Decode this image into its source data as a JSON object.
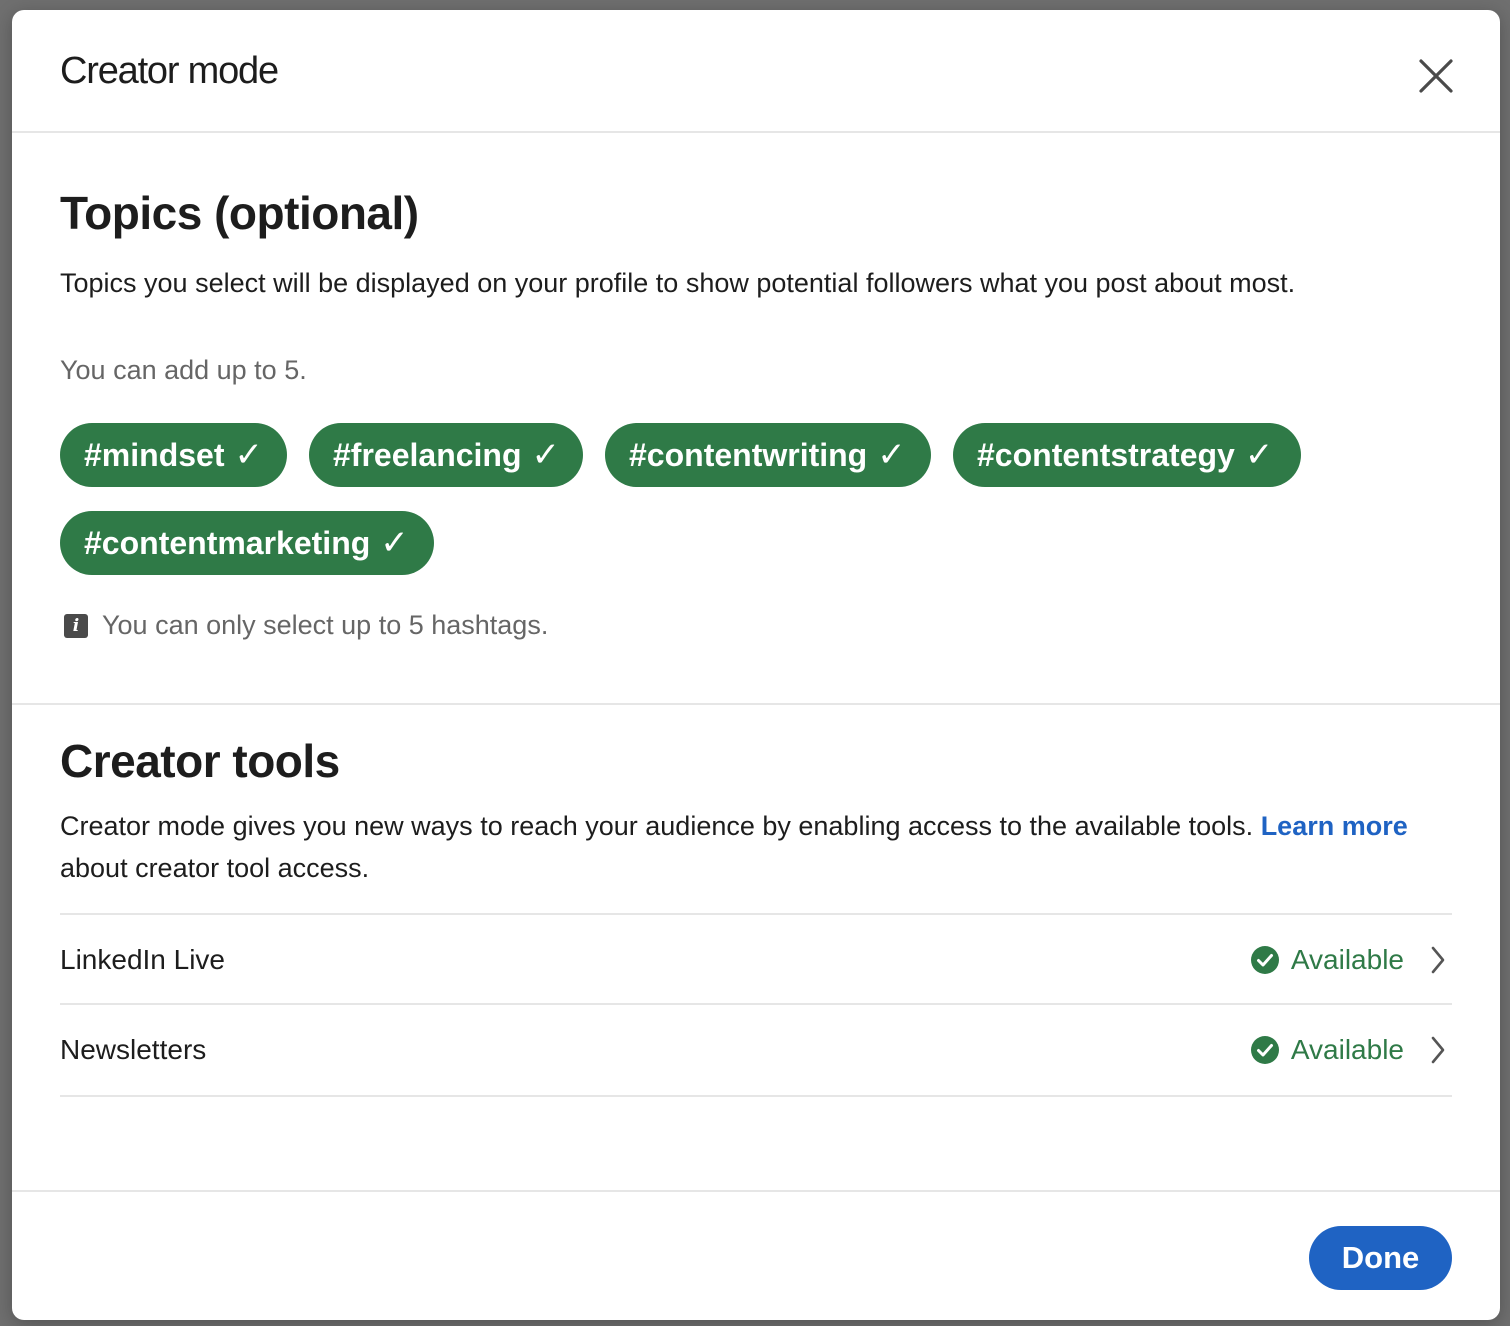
{
  "dialog": {
    "title": "Creator mode",
    "close_icon": "close-icon"
  },
  "topics": {
    "heading": "Topics (optional)",
    "description": "Topics you select will be displayed on your profile to show potential followers what you post about most.",
    "limit_text": "You can add up to 5.",
    "check_glyph": "✓",
    "chips": [
      {
        "label": "#mindset",
        "selected": true
      },
      {
        "label": "#freelancing",
        "selected": true
      },
      {
        "label": "#contentwriting",
        "selected": true
      },
      {
        "label": "#contentstrategy",
        "selected": true
      },
      {
        "label": "#contentmarketing",
        "selected": true
      }
    ],
    "info_icon": "info-icon",
    "info_message": "You can only select up to 5 hashtags."
  },
  "creator_tools": {
    "heading": "Creator tools",
    "description_before": "Creator mode gives you new ways to reach your audience by enabling access to the available tools. ",
    "learn_more_link": "Learn more",
    "description_after": " about creator tool access.",
    "items": [
      {
        "name": "LinkedIn Live",
        "status": "Available",
        "status_icon": "check-circle-icon"
      },
      {
        "name": "Newsletters",
        "status": "Available",
        "status_icon": "check-circle-icon"
      }
    ]
  },
  "footer": {
    "done_label": "Done"
  },
  "colors": {
    "chip_green": "#2f7a47",
    "link_blue": "#1f63c3",
    "status_green": "#2f7a47"
  }
}
